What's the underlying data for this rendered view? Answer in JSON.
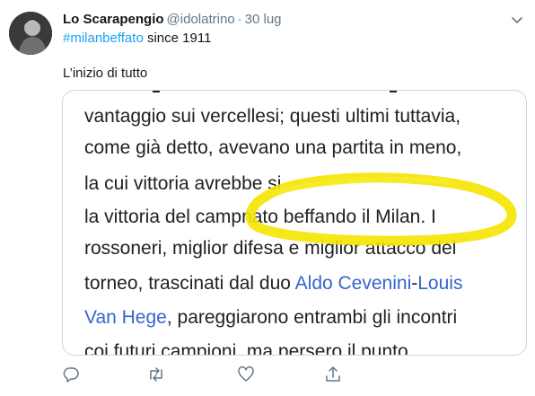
{
  "tweet": {
    "display_name": "Lo Scarapengio",
    "handle": "@idolatrino",
    "separator": "·",
    "date": "30 lug",
    "hashtag": "#milanbeffato",
    "bio_suffix": " since 1911",
    "text": "L’inizio di tutto"
  },
  "media": {
    "lines": [
      {
        "parts": [
          {
            "t": "vantaggio sui vercellesi; questi ultimi tuttavia,",
            "link": false
          }
        ]
      },
      {
        "parts": [
          {
            "t": "come già detto, avevano una partita in meno,",
            "link": false
          }
        ]
      },
      {
        "parts": [
          {
            "t": "la cui vittoria avrebbe si",
            "link": false
          }
        ]
      },
      {
        "parts": [
          {
            "t": "la vittoria del camp",
            "link": false
          },
          {
            "t": "nato beffando il Milan. I",
            "link": false
          }
        ]
      },
      {
        "parts": [
          {
            "t": "rossoneri, miglior difesa e miglior attacco del",
            "link": false
          }
        ]
      },
      {
        "parts": [
          {
            "t": "torneo, trascinati dal duo ",
            "link": false
          },
          {
            "t": "Aldo Cevenini",
            "link": true
          },
          {
            "t": "-",
            "link": false
          },
          {
            "t": "Louis",
            "link": true
          }
        ]
      },
      {
        "parts": [
          {
            "t": "Van Hege",
            "link": true
          },
          {
            "t": ", pareggiarono entrambi gli incontri",
            "link": false
          }
        ]
      },
      {
        "parts": [
          {
            "t": "coi futuri campioni, ma persero il punto",
            "link": false
          }
        ]
      }
    ],
    "highlight_color": "#f5e400"
  },
  "actions": [
    {
      "name": "reply-icon"
    },
    {
      "name": "retweet-icon"
    },
    {
      "name": "like-icon"
    },
    {
      "name": "share-icon"
    }
  ],
  "colors": {
    "link": "#1da1f2",
    "muted": "#657786",
    "wiki_link": "#3366cc"
  }
}
